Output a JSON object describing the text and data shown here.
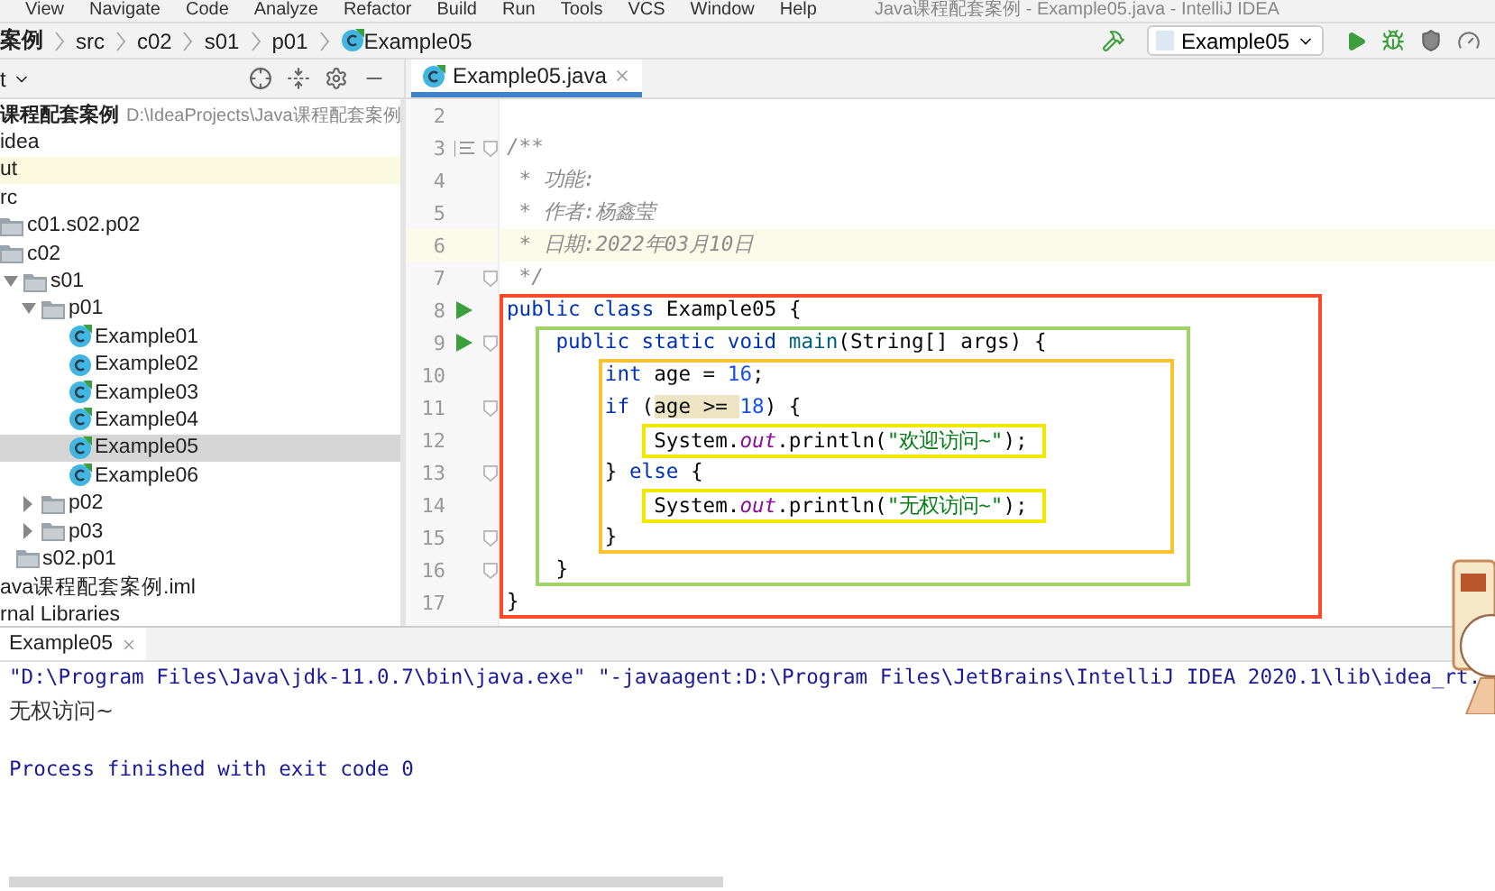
{
  "menu": [
    "View",
    "Navigate",
    "Code",
    "Analyze",
    "Refactor",
    "Build",
    "Run",
    "Tools",
    "VCS",
    "Window",
    "Help"
  ],
  "window_title": "Java课程配套案例 - Example05.java - IntelliJ IDEA",
  "breadcrumbs": [
    {
      "label": "案例",
      "kind": "project"
    },
    {
      "label": "src",
      "kind": "folder"
    },
    {
      "label": "c02",
      "kind": "folder"
    },
    {
      "label": "s01",
      "kind": "folder"
    },
    {
      "label": "p01",
      "kind": "folder"
    },
    {
      "label": "Example05",
      "kind": "class"
    }
  ],
  "run_config": {
    "label": "Example05"
  },
  "project_panel": {
    "title": "t"
  },
  "tree": [
    {
      "label": "课程配套案例",
      "path": "D:\\IdeaProjects\\Java课程配套案例",
      "kind": "root",
      "selected": false,
      "children": [
        {
          "label": "idea",
          "kind": "text",
          "selected": false
        },
        {
          "label": "ut",
          "kind": "excluded",
          "selected": false
        },
        {
          "label": "rc",
          "kind": "text",
          "selected": false,
          "children": [
            {
              "label": "c01.s02.p02",
              "kind": "folder",
              "selected": false
            },
            {
              "label": "c02",
              "kind": "folder",
              "selected": false,
              "children": [
                {
                  "label": "s01",
                  "kind": "folder",
                  "selected": false,
                  "expanded": true,
                  "children": [
                    {
                      "label": "p01",
                      "kind": "folder",
                      "selected": false,
                      "expanded": true,
                      "children": [
                        {
                          "label": "Example01",
                          "kind": "class",
                          "selected": false
                        },
                        {
                          "label": "Example02",
                          "kind": "class-plain",
                          "selected": false
                        },
                        {
                          "label": "Example03",
                          "kind": "class",
                          "selected": false
                        },
                        {
                          "label": "Example04",
                          "kind": "class",
                          "selected": false
                        },
                        {
                          "label": "Example05",
                          "kind": "class",
                          "selected": true
                        },
                        {
                          "label": "Example06",
                          "kind": "class",
                          "selected": false
                        }
                      ]
                    },
                    {
                      "label": "p02",
                      "kind": "folder",
                      "selected": false,
                      "expanded": false
                    },
                    {
                      "label": "p03",
                      "kind": "folder",
                      "selected": false,
                      "expanded": false
                    }
                  ]
                },
                {
                  "label": "s02.p01",
                  "kind": "folder",
                  "selected": false
                }
              ]
            }
          ]
        },
        {
          "label": "ava课程配套案例.iml",
          "kind": "text",
          "selected": false
        }
      ]
    },
    {
      "label": "rnal Libraries",
      "kind": "text",
      "selected": false
    }
  ],
  "editor": {
    "tabs": [
      {
        "label": "Example05.java",
        "selected": true
      }
    ],
    "code": [
      {
        "kind": "line",
        "number": "2",
        "fold": false,
        "runnable": false,
        "doc": false,
        "current": false
      },
      {
        "kind": "line",
        "number": "3",
        "fold": true,
        "runnable": false,
        "doc": true,
        "current": false,
        "tokens": [
          {
            "text": "/**",
            "kind": "comment"
          }
        ]
      },
      {
        "kind": "line",
        "number": "4",
        "fold": false,
        "runnable": false,
        "doc": false,
        "current": false,
        "tokens": [
          {
            "text": " * 功能:",
            "kind": "comment"
          }
        ]
      },
      {
        "kind": "line",
        "number": "5",
        "fold": false,
        "runnable": false,
        "doc": false,
        "current": false,
        "tokens": [
          {
            "text": " * 作者:杨鑫莹",
            "kind": "comment"
          }
        ]
      },
      {
        "kind": "line",
        "number": "6",
        "fold": false,
        "runnable": false,
        "doc": false,
        "current": true,
        "tokens": [
          {
            "text": " * 日期:2022年03月10日",
            "kind": "comment"
          }
        ]
      },
      {
        "kind": "line",
        "number": "7",
        "fold": true,
        "runnable": false,
        "doc": false,
        "current": false,
        "tokens": [
          {
            "text": " */",
            "kind": "comment"
          }
        ]
      },
      {
        "kind": "frame",
        "color": "#ff4a2a",
        "children": [
          {
            "kind": "line",
            "number": "8",
            "fold": false,
            "runnable": true,
            "doc": false,
            "current": false,
            "tokens": [
              {
                "text": "public class",
                "kind": "keyword"
              },
              {
                "text": " Example05 {",
                "kind": "plain"
              }
            ]
          },
          {
            "kind": "frame",
            "color": "#9ed36a",
            "children": [
              {
                "kind": "line",
                "number": "9",
                "fold": true,
                "runnable": true,
                "doc": false,
                "current": false,
                "tokens": [
                  {
                    "text": "public static void",
                    "kind": "keyword"
                  },
                  {
                    "text": " main",
                    "kind": "method"
                  },
                  {
                    "text": "(String[] args) {",
                    "kind": "plain"
                  }
                ]
              },
              {
                "kind": "frame",
                "color": "#ffc22e",
                "children": [
                  {
                    "kind": "line",
                    "number": "10",
                    "fold": false,
                    "runnable": false,
                    "doc": false,
                    "current": false,
                    "tokens": [
                      {
                        "text": "int",
                        "kind": "keyword"
                      },
                      {
                        "text": " age = ",
                        "kind": "plain"
                      },
                      {
                        "text": "16",
                        "kind": "number"
                      },
                      {
                        "text": ";",
                        "kind": "plain"
                      }
                    ]
                  },
                  {
                    "kind": "line",
                    "number": "11",
                    "fold": true,
                    "runnable": false,
                    "doc": false,
                    "current": false,
                    "tokens": [
                      {
                        "text": "if",
                        "kind": "keyword"
                      },
                      {
                        "text": " (",
                        "kind": "plain"
                      },
                      {
                        "text": "age >= ",
                        "kind": "match"
                      },
                      {
                        "text": "18",
                        "kind": "number"
                      },
                      {
                        "text": ") {",
                        "kind": "plain"
                      }
                    ]
                  },
                  {
                    "kind": "mark",
                    "color": "#f5e800",
                    "children": [
                      {
                        "kind": "line",
                        "number": "12",
                        "fold": false,
                        "runnable": false,
                        "doc": false,
                        "current": false,
                        "tokens": [
                          {
                            "text": "System.",
                            "kind": "plain"
                          },
                          {
                            "text": "out",
                            "kind": "field"
                          },
                          {
                            "text": ".println(",
                            "kind": "plain"
                          },
                          {
                            "text": "\"欢迎访问~\"",
                            "kind": "string"
                          },
                          {
                            "text": ");",
                            "kind": "plain"
                          }
                        ]
                      }
                    ]
                  },
                  {
                    "kind": "line",
                    "number": "13",
                    "fold": true,
                    "runnable": false,
                    "doc": false,
                    "current": false,
                    "tokens": [
                      {
                        "text": "} ",
                        "kind": "plain"
                      },
                      {
                        "text": "else",
                        "kind": "keyword"
                      },
                      {
                        "text": " {",
                        "kind": "plain"
                      }
                    ]
                  },
                  {
                    "kind": "mark",
                    "color": "#f5e800",
                    "children": [
                      {
                        "kind": "line",
                        "number": "14",
                        "fold": false,
                        "runnable": false,
                        "doc": false,
                        "current": false,
                        "tokens": [
                          {
                            "text": "System.",
                            "kind": "plain"
                          },
                          {
                            "text": "out",
                            "kind": "field"
                          },
                          {
                            "text": ".println(",
                            "kind": "plain"
                          },
                          {
                            "text": "\"无权访问~\"",
                            "kind": "string"
                          },
                          {
                            "text": ");",
                            "kind": "plain"
                          }
                        ]
                      }
                    ]
                  },
                  {
                    "kind": "line",
                    "number": "15",
                    "fold": true,
                    "runnable": false,
                    "doc": false,
                    "current": false,
                    "tokens": [
                      {
                        "text": "}",
                        "kind": "plain"
                      }
                    ]
                  }
                ]
              },
              {
                "kind": "line",
                "number": "16",
                "fold": true,
                "runnable": false,
                "doc": false,
                "current": false,
                "tokens": [
                  {
                    "text": "}",
                    "kind": "plain"
                  }
                ]
              }
            ]
          },
          {
            "kind": "line",
            "number": "17",
            "fold": false,
            "runnable": false,
            "doc": false,
            "current": false,
            "tokens": [
              {
                "text": "}",
                "kind": "plain"
              }
            ]
          }
        ]
      }
    ]
  },
  "run_panel": {
    "tabs": [
      {
        "label": "Example05",
        "selected": true
      }
    ],
    "lines": [
      {
        "kind": "command",
        "text": "\"D:\\Program Files\\Java\\jdk-11.0.7\\bin\\java.exe\" \"-javaagent:D:\\Program Files\\JetBrains\\IntelliJ IDEA 2020.1\\lib\\idea_rt."
      },
      {
        "kind": "output",
        "text": "无权访问~"
      },
      {
        "kind": "blank"
      },
      {
        "kind": "status",
        "text": "Process finished with exit code 0"
      }
    ]
  }
}
